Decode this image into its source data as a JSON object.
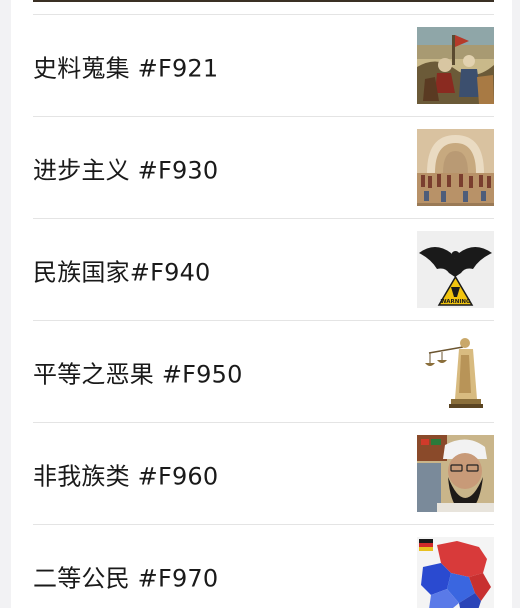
{
  "articles": [
    {
      "title": "史料蒐集 #F921",
      "thumb_icon": "battle-painting-icon"
    },
    {
      "title": "进步主义 #F930",
      "thumb_icon": "school-of-athens-icon"
    },
    {
      "title": "民族国家#F940",
      "thumb_icon": "eagle-emblem-icon",
      "thumb_caption": "WARNING"
    },
    {
      "title": "平等之恶果 #F950",
      "thumb_icon": "justice-statue-icon"
    },
    {
      "title": "非我族类 #F960",
      "thumb_icon": "bearded-man-portrait-icon"
    },
    {
      "title": "二等公民 #F970",
      "thumb_icon": "region-map-icon"
    }
  ]
}
